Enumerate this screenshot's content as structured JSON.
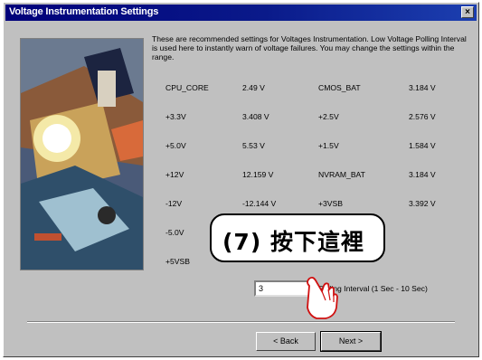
{
  "window": {
    "title": "Voltage Instrumentation Settings",
    "close_glyph": "×"
  },
  "description": "These are recommended settings for Voltages Instrumentation. Low Voltage Polling Interval is used here to instantly warn of voltage failures. You may change the settings within the range.",
  "voltages": [
    {
      "label": "CPU_CORE",
      "value": "2.49 V"
    },
    {
      "label": "CMOS_BAT",
      "value": "3.184 V"
    },
    {
      "label": "+3.3V",
      "value": "3.408 V"
    },
    {
      "label": "+2.5V",
      "value": "2.576 V"
    },
    {
      "label": "+5.0V",
      "value": "5.53 V"
    },
    {
      "label": "+1.5V",
      "value": "1.584 V"
    },
    {
      "label": "+12V",
      "value": "12.159 V"
    },
    {
      "label": "NVRAM_BAT",
      "value": "3.184 V"
    },
    {
      "label": "-12V",
      "value": "-12.144 V"
    },
    {
      "label": "+3VSB",
      "value": "3.392 V"
    },
    {
      "label": "-5.0V",
      "value": ""
    },
    {
      "label": "+5VSB",
      "value": ""
    }
  ],
  "callout": "(7) 按下這裡",
  "polling": {
    "value": "3",
    "label": "Polling Interval (1 Sec - 10 Sec)"
  },
  "buttons": {
    "back": "< Back",
    "next": "Next >"
  }
}
